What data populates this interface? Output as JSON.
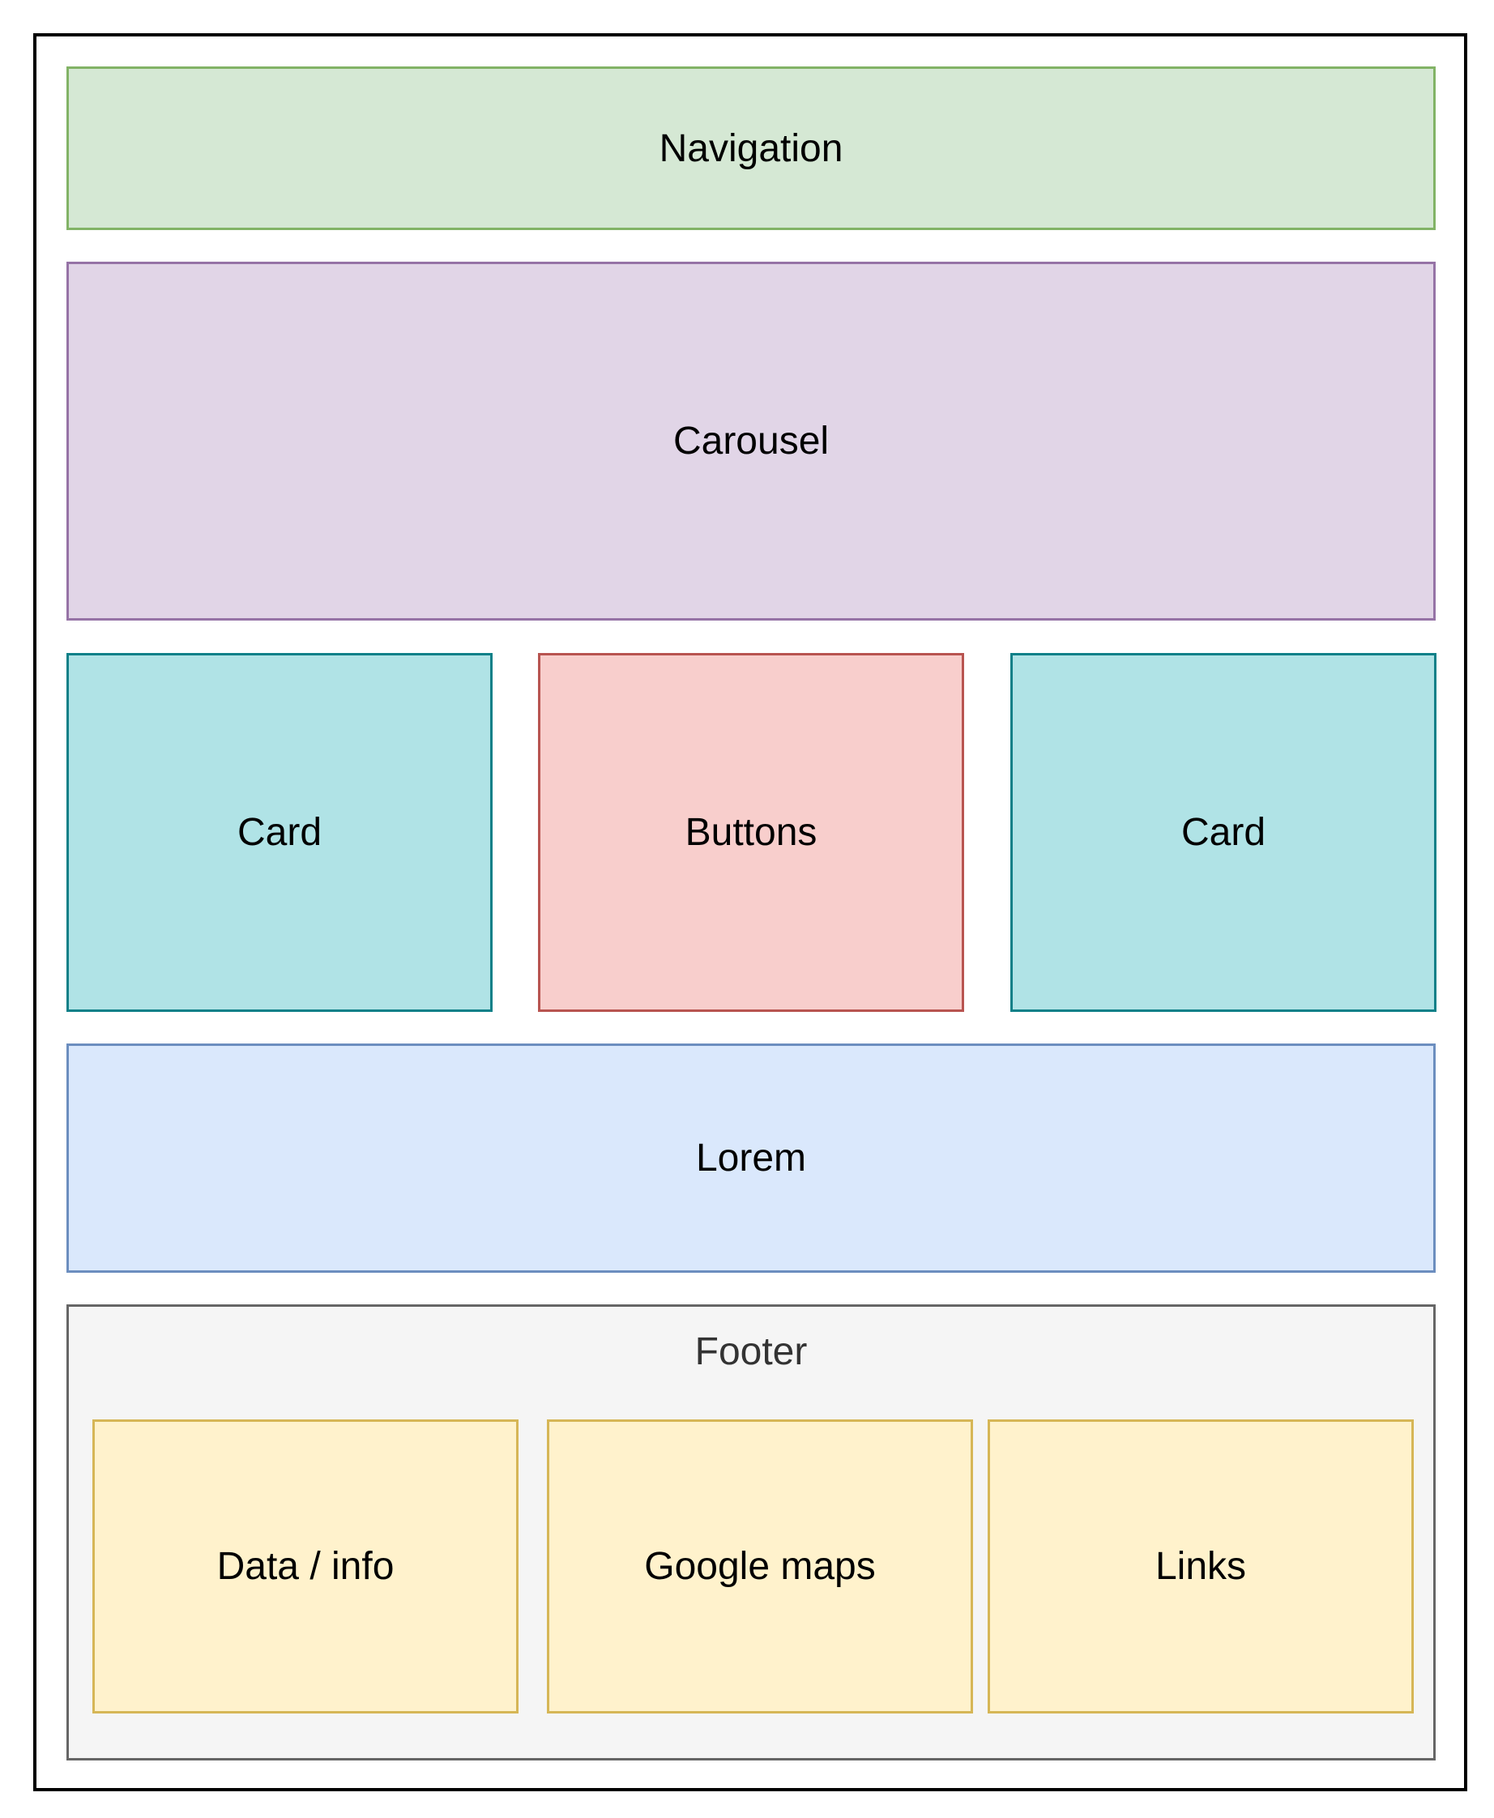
{
  "colors": {
    "navigation": {
      "fill": "#d5e8d4",
      "stroke": "#82b366"
    },
    "carousel": {
      "fill": "#e1d5e7",
      "stroke": "#9673a6"
    },
    "card": {
      "fill": "#b0e3e6",
      "stroke": "#0e8088"
    },
    "buttons": {
      "fill": "#f8cecc",
      "stroke": "#b85450"
    },
    "lorem": {
      "fill": "#dae8fc",
      "stroke": "#6c8ebf"
    },
    "footer": {
      "fill": "#f5f5f5",
      "stroke": "#666666",
      "text": "#333333"
    },
    "footer_item": {
      "fill": "#fff2cc",
      "stroke": "#d6b656"
    }
  },
  "layout": {
    "navigation": "Navigation",
    "carousel": "Carousel",
    "cards_row": {
      "left_card": "Card",
      "buttons": "Buttons",
      "right_card": "Card"
    },
    "lorem": "Lorem",
    "footer": {
      "title": "Footer",
      "items": [
        "Data / info",
        "Google maps",
        "Links"
      ]
    }
  }
}
